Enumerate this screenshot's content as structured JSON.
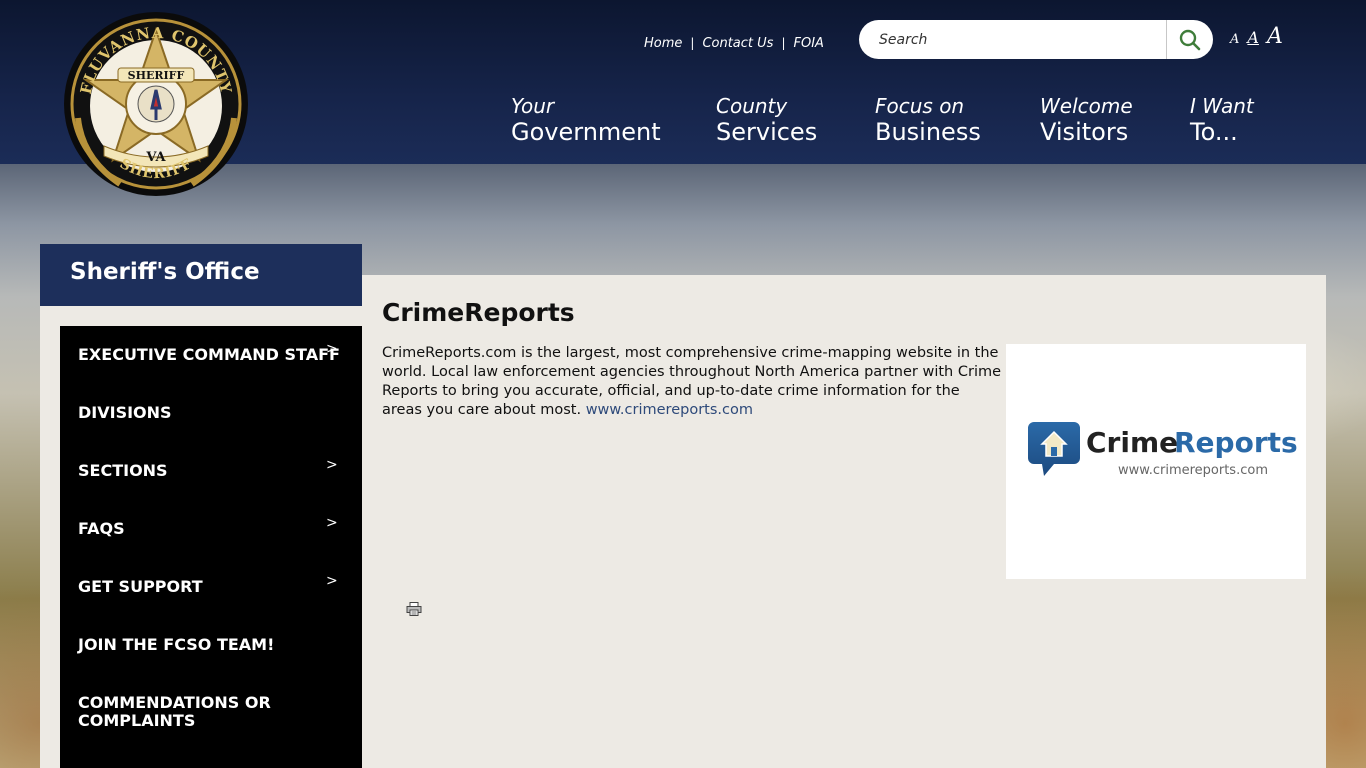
{
  "header": {
    "utility_links": [
      "Home",
      "Contact Us",
      "FOIA"
    ],
    "utility_separator": "|",
    "search": {
      "placeholder": "Search"
    },
    "text_size": [
      "A",
      "A",
      "A"
    ],
    "seal_text": {
      "top": "FLUVANNA COUNTY",
      "banner": "SHERIFF",
      "state": "VA",
      "bottom": "SHERIFF"
    },
    "main_nav": [
      {
        "line1": "Your",
        "line2": "Government"
      },
      {
        "line1": "County",
        "line2": "Services"
      },
      {
        "line1": "Focus on",
        "line2": "Business"
      },
      {
        "line1": "Welcome",
        "line2": "Visitors"
      },
      {
        "line1": "I Want",
        "line2": "To..."
      }
    ]
  },
  "sidebar": {
    "title": "Sheriff's Office",
    "items": [
      {
        "label": "EXECUTIVE COMMAND STAFF",
        "chevron": ">"
      },
      {
        "label": "DIVISIONS",
        "chevron": ""
      },
      {
        "label": "SECTIONS",
        "chevron": ">"
      },
      {
        "label": "FAQS",
        "chevron": ">"
      },
      {
        "label": "GET SUPPORT",
        "chevron": ">"
      },
      {
        "label": "JOIN THE FCSO TEAM!",
        "chevron": ""
      },
      {
        "label": "COMMENDATIONS OR COMPLAINTS",
        "chevron": ""
      }
    ]
  },
  "main": {
    "title": "CrimeReports",
    "body": "CrimeReports.com is the largest, most comprehensive crime-mapping website in the world. Local law enforcement agencies throughout North America partner with Crime Reports to bring you accurate, official, and up-to-date crime information for the areas you care about most.",
    "link_text": "www.crimereports.com",
    "logo": {
      "word1": "Crime",
      "word2": "Reports",
      "url": "www.crimereports.com"
    }
  },
  "colors": {
    "header_navy": "#16244a",
    "sidebar_title_bg": "#1d2f5b",
    "sidebar_nav_bg": "#000000",
    "content_bg": "#edeae4",
    "link": "#2e4a7a",
    "search_icon_green": "#3f7d3a"
  },
  "icons": {
    "search_button": "search-icon",
    "print": "printer-icon"
  }
}
